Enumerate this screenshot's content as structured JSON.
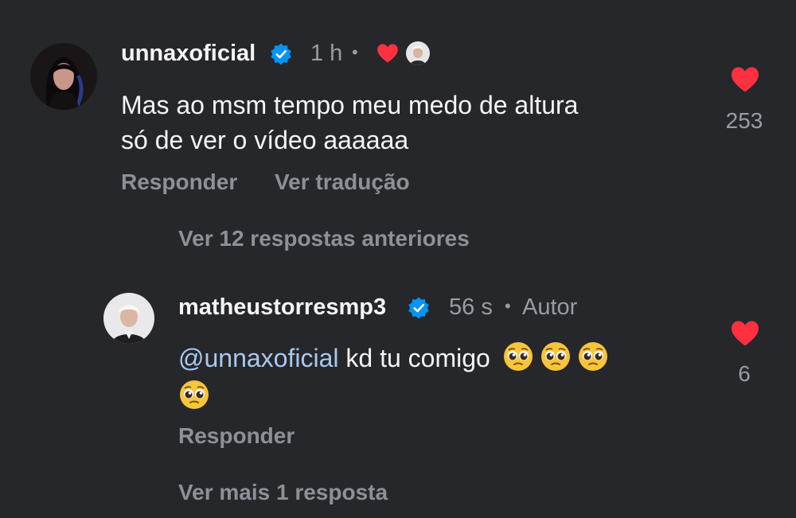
{
  "comments": [
    {
      "username": "unnaxoficial",
      "time": "1 h",
      "dot": "•",
      "text_line1": "Mas ao msm tempo meu medo de altura",
      "text_line2": "só de ver o vídeo aaaaaa",
      "reply_label": "Responder",
      "translate_label": "Ver tradução",
      "like_count": "253"
    },
    {
      "username": "matheustorresmp3",
      "time": "56 s",
      "dot": "•",
      "author_label": "Autor",
      "mention": "@unnaxoficial",
      "text": " kd tu comigo",
      "reply_label": "Responder",
      "like_count": "6"
    }
  ],
  "view_previous_replies": "Ver 12 respostas anteriores",
  "view_more_replies": "Ver mais 1 resposta",
  "colors": {
    "background": "#26272b",
    "heart": "#ff3040",
    "verified": "#0095f6",
    "mention": "#a9c9ee"
  },
  "icons": [
    "verified-badge-icon",
    "heart-icon",
    "pleading-face-emoji"
  ]
}
